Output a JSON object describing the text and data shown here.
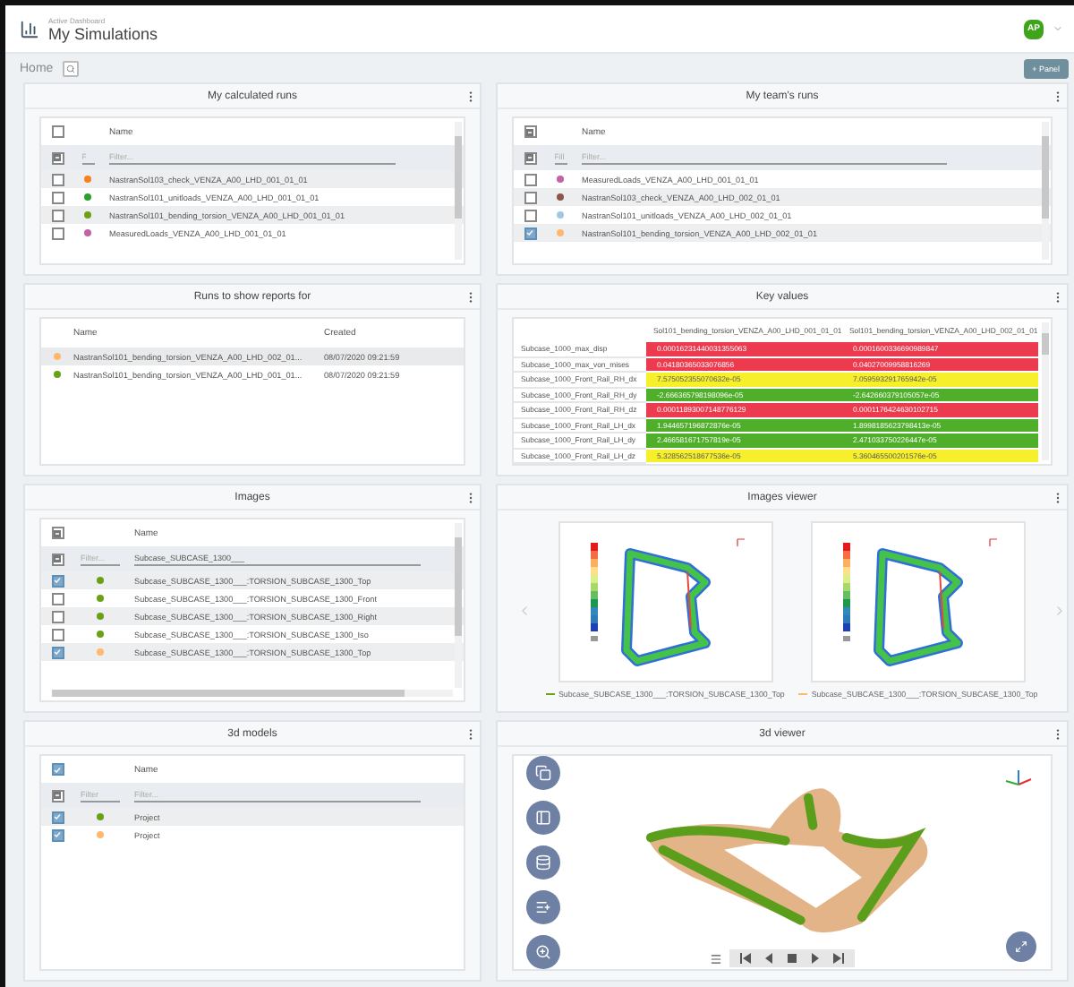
{
  "header": {
    "subtitle": "Active Dashboard",
    "title": "My Simulations",
    "avatar": "AP"
  },
  "breadcrumb": "Home",
  "add_panel_button": "+ Panel",
  "panels": [
    {
      "kind": "list",
      "title": "My calculated runs",
      "header_checkbox": {
        "checked": false
      },
      "column": "Name",
      "filter_checkbox": {
        "mixed": true
      },
      "color_filter_placeholder": "F",
      "filter_placeholder": "Filter...",
      "rows": [
        {
          "color": "#f5821f",
          "name": "NastranSol103_check_VENZA_A00_LHD_001_01_01",
          "checked": false
        },
        {
          "color": "#2ca02c",
          "name": "NastranSol101_unitloads_VENZA_A00_LHD_001_01_01",
          "checked": false
        },
        {
          "color": "#6aa116",
          "name": "NastranSol101_bending_torsion_VENZA_A00_LHD_001_01_01",
          "checked": false
        },
        {
          "color": "#c263a6",
          "name": "MeasuredLoads_VENZA_A00_LHD_001_01_01",
          "checked": false
        }
      ]
    },
    {
      "kind": "list",
      "title": "My team's runs",
      "header_checkbox": {
        "mixed": true
      },
      "column": "Name",
      "filter_checkbox": {
        "mixed": true
      },
      "color_filter_placeholder": "Fill",
      "filter_placeholder": "Filter...",
      "rows": [
        {
          "color": "#c263a6",
          "name": "MeasuredLoads_VENZA_A00_LHD_001_01_01",
          "checked": false
        },
        {
          "color": "#8c564b",
          "name": "NastranSol103_check_VENZA_A00_LHD_002_01_01",
          "checked": false
        },
        {
          "color": "#9ecae1",
          "name": "NastranSol101_unitloads_VENZA_A00_LHD_002_01_01",
          "checked": false
        },
        {
          "color": "#ffb870",
          "name": "NastranSol101_bending_torsion_VENZA_A00_LHD_002_01_01",
          "checked": true
        }
      ]
    },
    {
      "kind": "reports",
      "title": "Runs to show reports for",
      "columns": [
        "Name",
        "Created"
      ],
      "rows": [
        {
          "color": "#ffb870",
          "name": "NastranSol101_bending_torsion_VENZA_A00_LHD_002_01...",
          "created": "08/07/2020 09:21:59",
          "selected": true
        },
        {
          "color": "#6aa116",
          "name": "NastranSol101_bending_torsion_VENZA_A00_LHD_001_01...",
          "created": "08/07/2020 09:21:59",
          "selected": false
        }
      ]
    },
    {
      "kind": "keyvalues",
      "title": "Key values",
      "columns": [
        "Sol101_bending_torsion_VENZA_A00_LHD_001_01_01",
        "Sol101_bending_torsion_VENZA_A00_LHD_002_01_01"
      ],
      "rows": [
        {
          "label": "Subcase_1000_max_disp",
          "cells": [
            {
              "value": "0.00016231440031355063",
              "color": "#ec3b4f"
            },
            {
              "value": "0.0001600336690989847",
              "color": "#ec3b4f"
            }
          ]
        },
        {
          "label": "Subcase_1000_max_von_mises",
          "cells": [
            {
              "value": "0.04180365033076856",
              "color": "#ec3b4f"
            },
            {
              "value": "0.04027009958816269",
              "color": "#ec3b4f"
            }
          ]
        },
        {
          "label": "Subcase_1000_Front_Rail_RH_dx",
          "cells": [
            {
              "value": "7.575052355070632e-05",
              "color": "#f6f02c"
            },
            {
              "value": "7.059593291765942e-05",
              "color": "#f6f02c"
            }
          ]
        },
        {
          "label": "Subcase_1000_Front_Rail_RH_dy",
          "cells": [
            {
              "value": "-2.666365798198096e-05",
              "color": "#4fae2a"
            },
            {
              "value": "-2.642660379105057e-05",
              "color": "#4fae2a"
            }
          ]
        },
        {
          "label": "Subcase_1000_Front_Rail_RH_dz",
          "cells": [
            {
              "value": "0.00011893007148776129",
              "color": "#ec3b4f"
            },
            {
              "value": "0.0001176424630102715",
              "color": "#ec3b4f"
            }
          ]
        },
        {
          "label": "Subcase_1000_Front_Rail_LH_dx",
          "cells": [
            {
              "value": "1.944657196872876e-05",
              "color": "#4fae2a"
            },
            {
              "value": "1.8998185623798413e-05",
              "color": "#4fae2a"
            }
          ]
        },
        {
          "label": "Subcase_1000_Front_Rail_LH_dy",
          "cells": [
            {
              "value": "2.466581671757819e-05",
              "color": "#4fae2a"
            },
            {
              "value": "2.471033750226447e-05",
              "color": "#4fae2a"
            }
          ]
        },
        {
          "label": "Subcase_1000_Front_Rail_LH_dz",
          "cells": [
            {
              "value": "5.328562518677536e-05",
              "color": "#f6f02c"
            },
            {
              "value": "5.360465500201576e-05",
              "color": "#f6f02c"
            }
          ]
        }
      ]
    },
    {
      "kind": "list",
      "title": "Images",
      "header_checkbox": {
        "mixed": true
      },
      "column": "Name",
      "filter_checkbox": {
        "mixed": true
      },
      "color_filter_placeholder": "Filter...",
      "filter_value": "Subcase_SUBCASE_1300___",
      "rows": [
        {
          "color": "#6aa116",
          "name": "Subcase_SUBCASE_1300___:TORSION_SUBCASE_1300_Top",
          "checked": true
        },
        {
          "color": "#6aa116",
          "name": "Subcase_SUBCASE_1300___:TORSION_SUBCASE_1300_Front",
          "checked": false
        },
        {
          "color": "#6aa116",
          "name": "Subcase_SUBCASE_1300___:TORSION_SUBCASE_1300_Right",
          "checked": false
        },
        {
          "color": "#6aa116",
          "name": "Subcase_SUBCASE_1300___:TORSION_SUBCASE_1300_Iso",
          "checked": false
        },
        {
          "color": "#ffb870",
          "name": "Subcase_SUBCASE_1300___:TORSION_SUBCASE_1300_Top",
          "checked": true
        }
      ]
    },
    {
      "kind": "imageviewer",
      "title": "Images viewer",
      "images": [
        {
          "caption": "Subcase_SUBCASE_1300___:TORSION_SUBCASE_1300_Top",
          "color": "#6aa116"
        },
        {
          "caption": "Subcase_SUBCASE_1300___:TORSION_SUBCASE_1300_Top",
          "color": "#ffb870"
        }
      ]
    },
    {
      "kind": "list",
      "title": "3d models",
      "header_checkbox": {
        "checked": true
      },
      "column": "Name",
      "filter_checkbox": {
        "mixed": true
      },
      "color_filter_placeholder": "Filter",
      "filter_placeholder": "Filter...",
      "rows": [
        {
          "color": "#6aa116",
          "name": "Project",
          "checked": true
        },
        {
          "color": "#ffb870",
          "name": "Project",
          "checked": true
        }
      ]
    },
    {
      "kind": "viewer3d",
      "title": "3d viewer"
    }
  ]
}
